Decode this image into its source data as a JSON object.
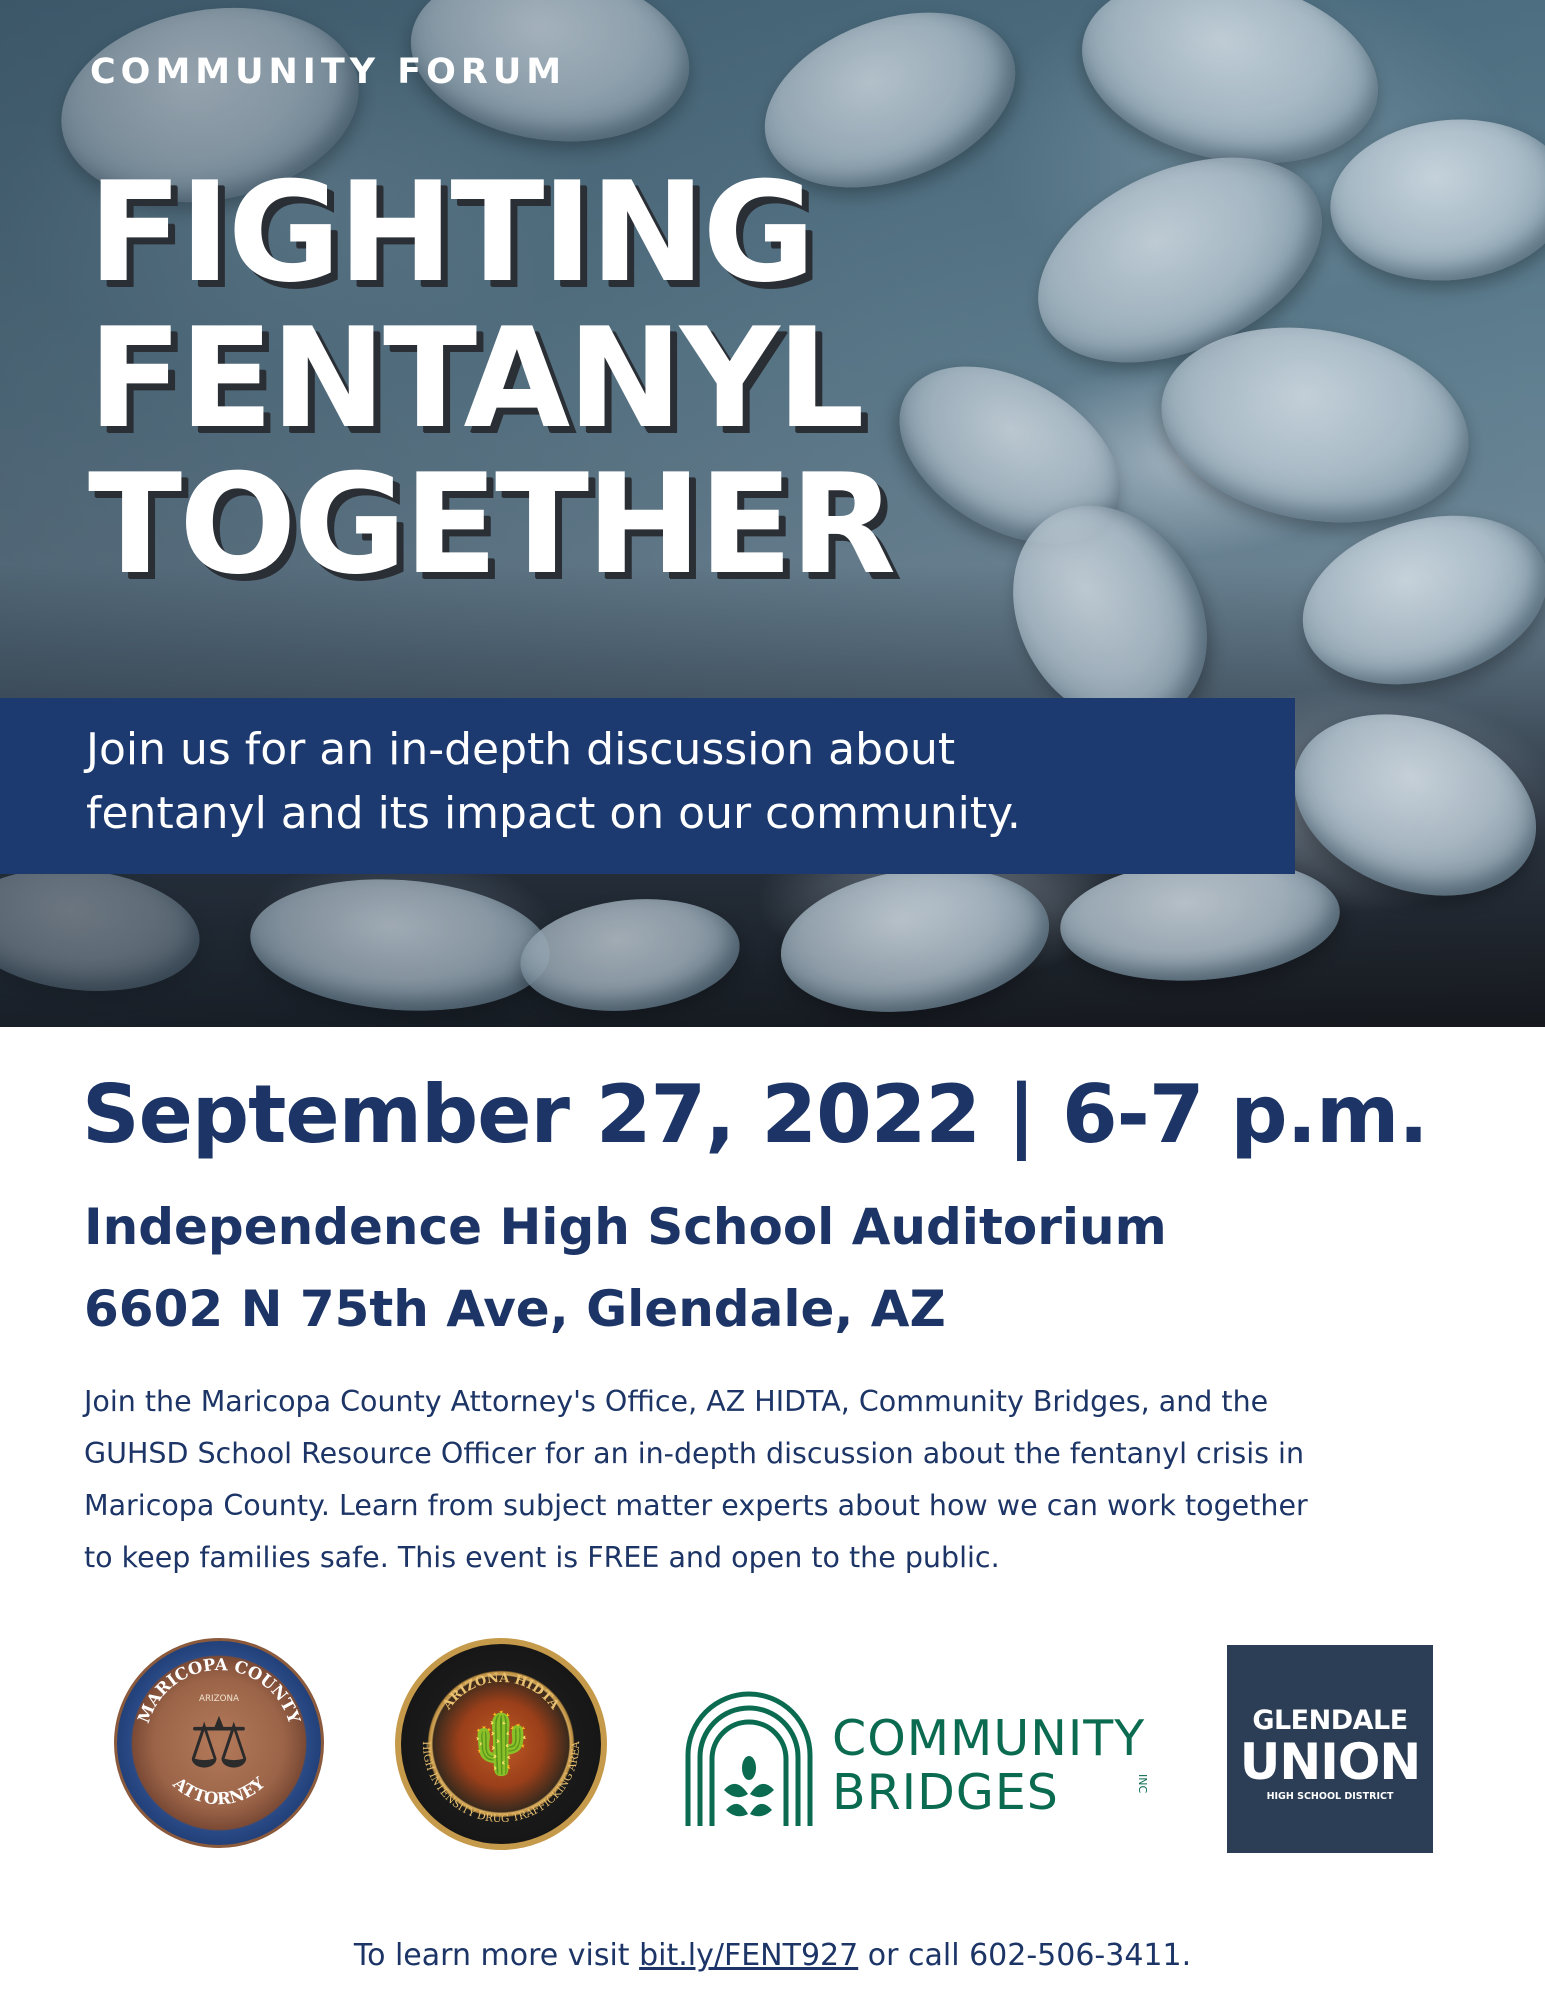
{
  "hero": {
    "kicker": "COMMUNITY FORUM",
    "headline_lines": [
      "FIGHTING",
      "FENTANYL",
      "TOGETHER"
    ],
    "intro_lines": [
      "Join us for an in-depth discussion about",
      "fentanyl and its impact on our community."
    ],
    "background_image": "blue pills"
  },
  "event": {
    "date_time": "September 27, 2022 | 6-7 p.m.",
    "venue": "Independence High School Auditorium",
    "address": "6602 N 75th Ave, Glendale, AZ",
    "description_lines": [
      "Join the Maricopa County Attorney's Office, AZ HIDTA, Community Bridges, and the",
      "GUHSD School Resource Officer for an in-depth discussion about the fentanyl crisis in",
      "Maricopa County. Learn from subject matter experts about how we can work together",
      "to keep families safe. This event is FREE and open to the public."
    ]
  },
  "logos": {
    "maricopa": {
      "top_text": "MARICOPA COUNTY",
      "middle_text": "ARIZONA",
      "bottom_text": "ATTORNEY",
      "icon": "scales-icon"
    },
    "hidta": {
      "top_text": "ARIZONA HIDTA",
      "bottom_text": "HIGH INTENSITY DRUG TRAFFICKING AREA",
      "icon": "cactus-icon"
    },
    "community_bridges": {
      "line1": "COMMUNITY",
      "line2": "BRIDGES",
      "suffix": "INC"
    },
    "glendale": {
      "line1": "GLENDALE",
      "line2": "UNION",
      "line3": "HIGH SCHOOL DISTRICT"
    }
  },
  "footer": {
    "prefix": "To learn more visit ",
    "link": "bit.ly/FENT927",
    "suffix": " or call 602-506-3411."
  },
  "colors": {
    "navy": "#1c3566",
    "band": "#1c3970",
    "community_bridges_green": "#0b6b50",
    "glendale_box": "#2c3e55"
  }
}
